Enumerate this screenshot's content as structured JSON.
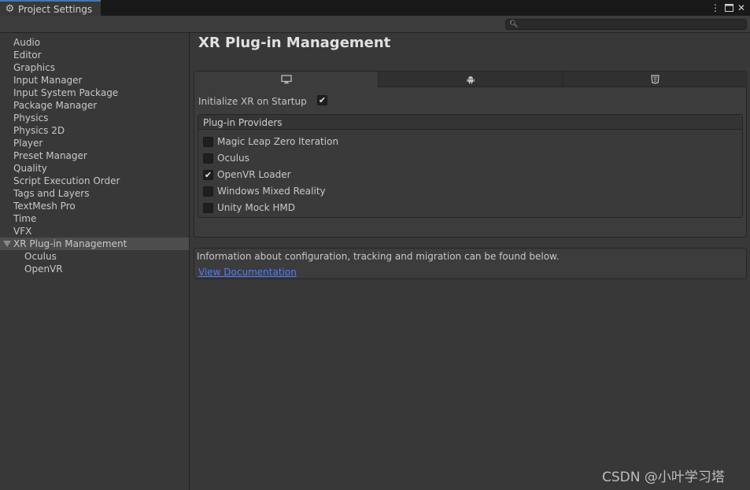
{
  "window": {
    "tab_title": "Project Settings",
    "tab_icon": "gear-icon",
    "menu_icon": "kebab-menu-icon",
    "maximize_icon": "maximize-icon",
    "close_icon": "close-icon",
    "accent_color": "#3a79bb"
  },
  "search": {
    "value": "",
    "icon": "search-icon"
  },
  "sidebar": {
    "items": [
      {
        "label": "Audio"
      },
      {
        "label": "Editor"
      },
      {
        "label": "Graphics"
      },
      {
        "label": "Input Manager"
      },
      {
        "label": "Input System Package"
      },
      {
        "label": "Package Manager"
      },
      {
        "label": "Physics"
      },
      {
        "label": "Physics 2D"
      },
      {
        "label": "Player"
      },
      {
        "label": "Preset Manager"
      },
      {
        "label": "Quality"
      },
      {
        "label": "Script Execution Order"
      },
      {
        "label": "Tags and Layers"
      },
      {
        "label": "TextMesh Pro"
      },
      {
        "label": "Time"
      },
      {
        "label": "VFX"
      },
      {
        "label": "XR Plug-in Management",
        "selected": true,
        "expanded": true
      },
      {
        "label": "Oculus",
        "child": true
      },
      {
        "label": "OpenVR",
        "child": true
      }
    ]
  },
  "main": {
    "title": "XR Plug-in Management",
    "platform_tabs": [
      {
        "icon": "desktop-icon",
        "active": true
      },
      {
        "icon": "android-icon",
        "active": false
      },
      {
        "icon": "html5-icon",
        "active": false
      }
    ],
    "init_on_startup": {
      "label": "Initialize XR on Startup",
      "checked": true
    },
    "providers": {
      "header": "Plug-in Providers",
      "items": [
        {
          "label": "Magic Leap Zero Iteration",
          "checked": false
        },
        {
          "label": "Oculus",
          "checked": false
        },
        {
          "label": "OpenVR Loader",
          "checked": true
        },
        {
          "label": "Windows Mixed Reality",
          "checked": false
        },
        {
          "label": "Unity Mock HMD",
          "checked": false
        }
      ]
    },
    "info": {
      "text": "Information about configuration, tracking and migration can be found below.",
      "link": "View Documentation",
      "link_color": "#4c7eff"
    }
  },
  "watermark": "CSDN @小叶学习塔"
}
